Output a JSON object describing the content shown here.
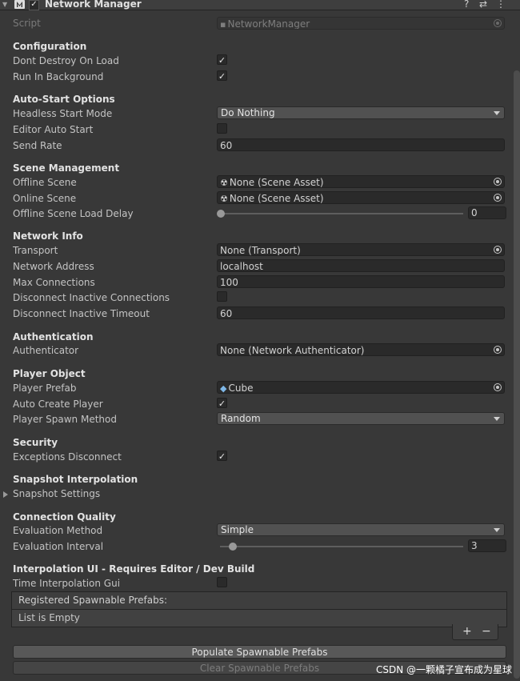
{
  "header": {
    "title": "Network Manager",
    "fold_icon": "triangle-down-icon",
    "component_icon": "mirror-logo-icon",
    "enabled": true,
    "help_glyph": "?",
    "settings_glyph": "⇄",
    "menu_glyph": "⋮"
  },
  "script": {
    "label": "Script",
    "value": "NetworkManager"
  },
  "configuration": {
    "title": "Configuration",
    "dont_destroy_label": "Dont Destroy On Load",
    "dont_destroy": true,
    "run_bg_label": "Run In Background",
    "run_bg": true
  },
  "auto_start": {
    "title": "Auto-Start Options",
    "headless_label": "Headless Start Mode",
    "headless_value": "Do Nothing",
    "editor_auto_label": "Editor Auto Start",
    "editor_auto": false,
    "send_rate_label": "Send Rate",
    "send_rate": "60"
  },
  "scene": {
    "title": "Scene Management",
    "offline_label": "Offline Scene",
    "offline_value": "None (Scene Asset)",
    "online_label": "Online Scene",
    "online_value": "None (Scene Asset)",
    "delay_label": "Offline Scene Load Delay",
    "delay_value": "0"
  },
  "network": {
    "title": "Network Info",
    "transport_label": "Transport",
    "transport_value": "None (Transport)",
    "address_label": "Network Address",
    "address_value": "localhost",
    "max_conn_label": "Max Connections",
    "max_conn_value": "100",
    "disc_inactive_label": "Disconnect Inactive Connections",
    "disc_inactive": false,
    "disc_timeout_label": "Disconnect Inactive Timeout",
    "disc_timeout_value": "60"
  },
  "auth": {
    "title": "Authentication",
    "authenticator_label": "Authenticator",
    "authenticator_value": "None (Network Authenticator)"
  },
  "player": {
    "title": "Player Object",
    "prefab_label": "Player Prefab",
    "prefab_value": "Cube",
    "auto_create_label": "Auto Create Player",
    "auto_create": true,
    "spawn_method_label": "Player Spawn Method",
    "spawn_method_value": "Random"
  },
  "security": {
    "title": "Security",
    "exceptions_label": "Exceptions Disconnect",
    "exceptions": true
  },
  "snapshot": {
    "title": "Snapshot Interpolation",
    "settings_label": "Snapshot Settings"
  },
  "quality": {
    "title": "Connection Quality",
    "method_label": "Evaluation Method",
    "method_value": "Simple",
    "interval_label": "Evaluation Interval",
    "interval_value": "3"
  },
  "interp_ui": {
    "title": "Interpolation UI - Requires Editor / Dev Build",
    "time_gui_label": "Time Interpolation Gui",
    "time_gui": false
  },
  "prefabs_list": {
    "header": "Registered Spawnable Prefabs:",
    "empty_text": "List is Empty",
    "add_glyph": "+",
    "remove_glyph": "−"
  },
  "buttons": {
    "populate": "Populate Spawnable Prefabs",
    "clear": "Clear Spawnable Prefabs"
  },
  "watermark": "CSDN @一颗橘子宣布成为星球"
}
